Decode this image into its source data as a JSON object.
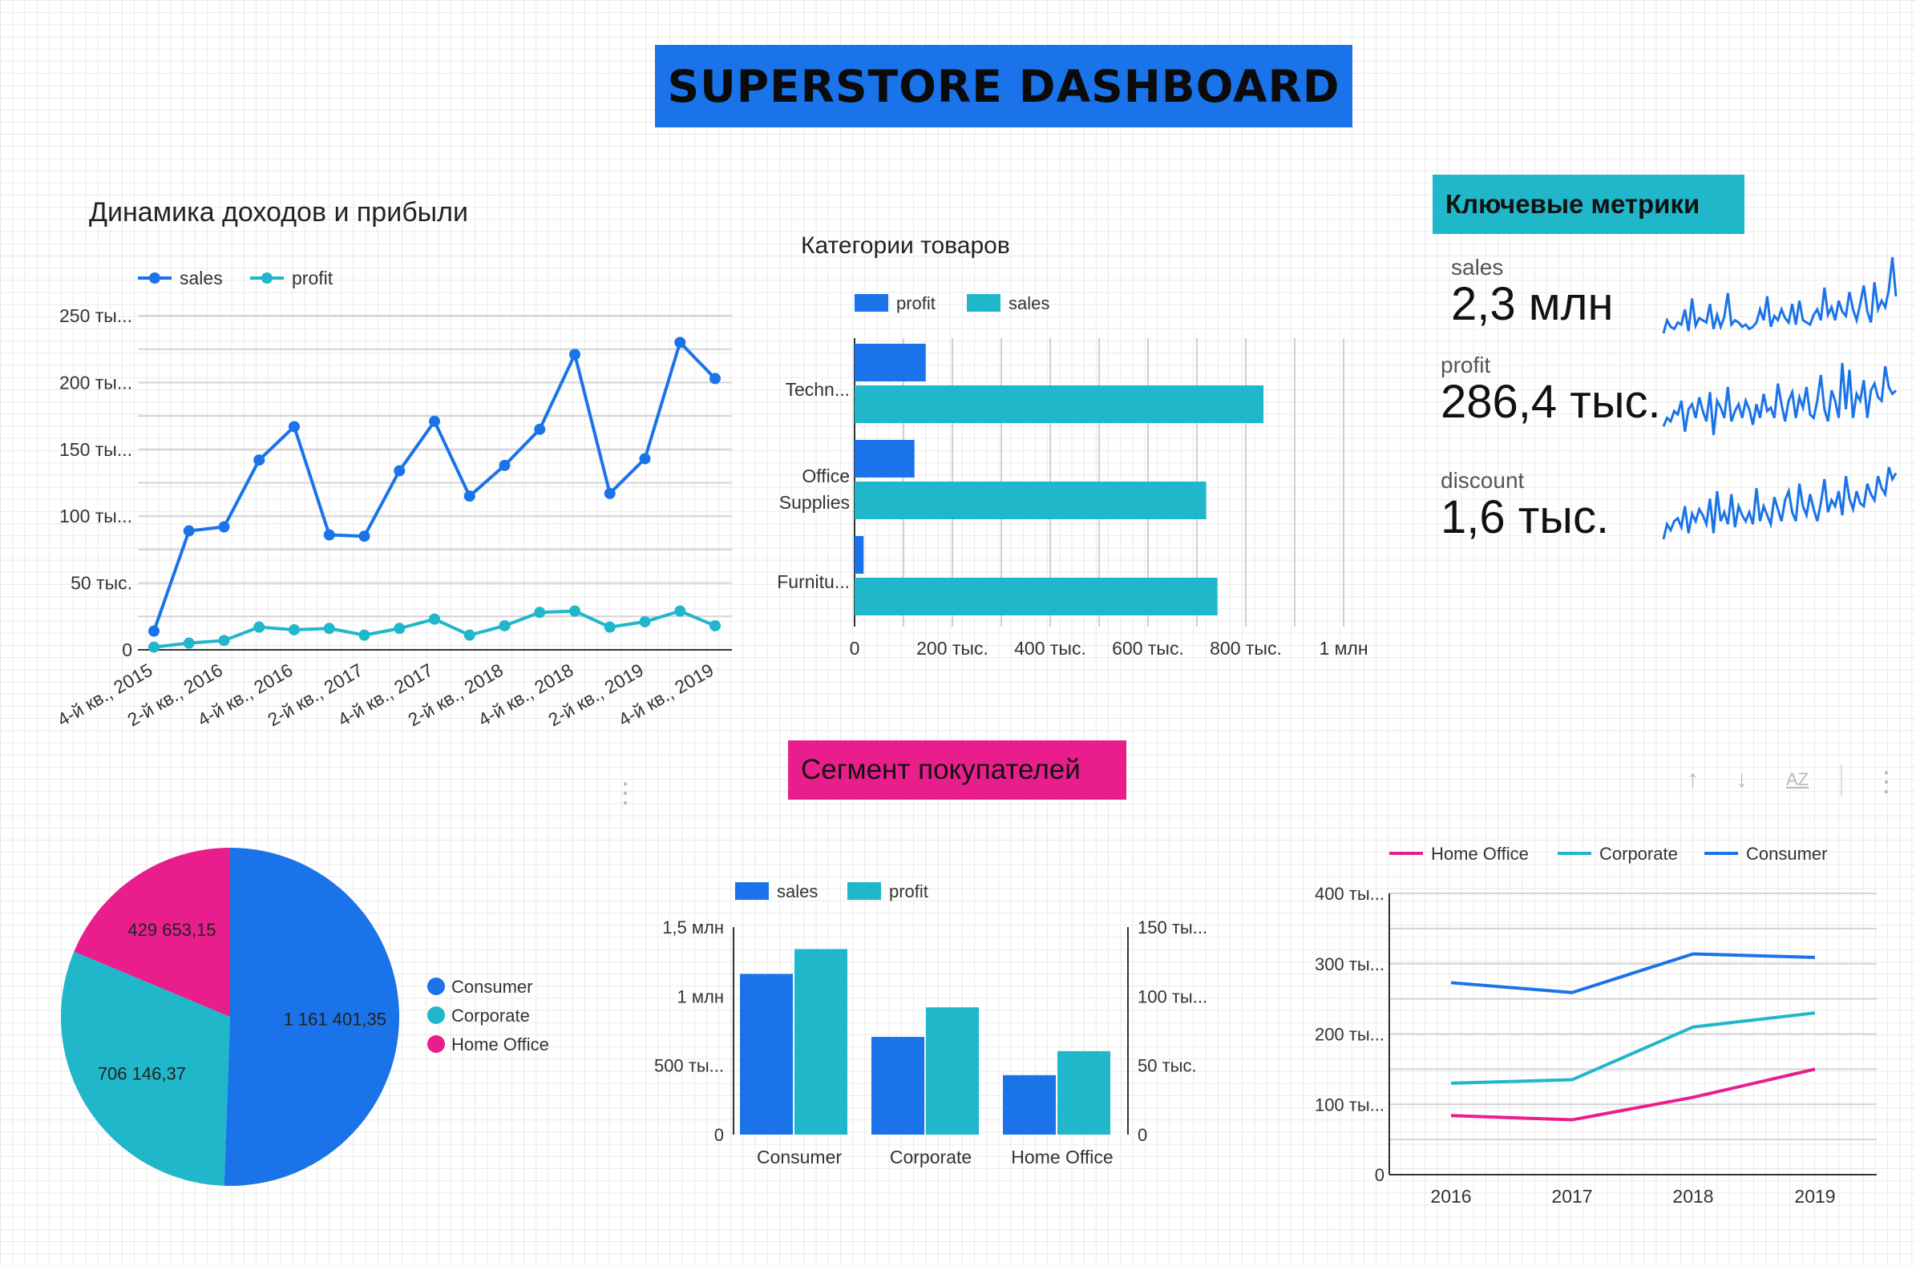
{
  "dashboard": {
    "title": "SUPERSTORE DASHBOARD",
    "metrics_header": "Ключевые метрики",
    "segment_header": "Сегмент покупателей"
  },
  "colors": {
    "blue": "#1a73e8",
    "teal": "#1fb7c9",
    "pink": "#e91e8c"
  },
  "metrics": [
    {
      "label": "sales",
      "value": "2,3 млн",
      "spark": [
        18,
        30,
        24,
        22,
        28,
        26,
        40,
        20,
        50,
        25,
        32,
        30,
        28,
        45,
        22,
        35,
        24,
        33,
        55,
        26,
        30,
        28,
        24,
        26,
        22,
        24,
        28,
        40,
        30,
        52,
        24,
        34,
        30,
        40,
        32,
        28,
        45,
        26,
        48,
        30,
        28,
        26,
        35,
        40,
        30,
        60,
        35,
        42,
        30,
        48,
        38,
        34,
        56,
        40,
        30,
        45,
        62,
        38,
        28,
        65,
        40,
        48,
        42,
        58,
        88,
        52
      ]
    },
    {
      "label": "profit",
      "value": "286,4 тыс.",
      "spark": [
        25,
        30,
        28,
        34,
        32,
        40,
        22,
        35,
        38,
        30,
        42,
        34,
        28,
        45,
        20,
        40,
        36,
        30,
        48,
        28,
        34,
        38,
        30,
        40,
        35,
        26,
        38,
        30,
        44,
        34,
        36,
        30,
        50,
        38,
        28,
        40,
        45,
        30,
        42,
        36,
        48,
        32,
        30,
        40,
        55,
        35,
        28,
        46,
        40,
        30,
        62,
        35,
        58,
        30,
        44,
        40,
        52,
        30,
        46,
        50,
        42,
        40,
        60,
        48,
        44,
        46
      ]
    },
    {
      "label": "discount",
      "value": "1,6 тыс.",
      "spark": [
        18,
        28,
        24,
        30,
        32,
        26,
        40,
        22,
        35,
        30,
        38,
        34,
        28,
        45,
        22,
        50,
        30,
        36,
        28,
        48,
        26,
        40,
        34,
        30,
        36,
        28,
        52,
        30,
        40,
        34,
        28,
        46,
        38,
        30,
        44,
        50,
        36,
        30,
        55,
        40,
        34,
        48,
        38,
        30,
        42,
        58,
        36,
        44,
        40,
        50,
        34,
        60,
        45,
        38,
        50,
        42,
        40,
        55,
        48,
        44,
        60,
        52,
        48,
        66,
        58,
        62
      ]
    }
  ],
  "chart_data": [
    {
      "id": "revenue-profit-trend",
      "type": "line",
      "title": "Динамика доходов и прибыли",
      "x": [
        "4-й кв., 2015",
        "1-й кв., 2016",
        "2-й кв., 2016",
        "3-й кв., 2016",
        "4-й кв., 2016",
        "1-й кв., 2017",
        "2-й кв., 2017",
        "3-й кв., 2017",
        "4-й кв., 2017",
        "1-й кв., 2018",
        "2-й кв., 2018",
        "3-й кв., 2018",
        "4-й кв., 2018",
        "1-й кв., 2019",
        "2-й кв., 2019",
        "3-й кв., 2019",
        "4-й кв., 2019"
      ],
      "x_tick_labels": [
        "4-й кв., 2015",
        "2-й кв., 2016",
        "4-й кв., 2016",
        "2-й кв., 2017",
        "4-й кв., 2017",
        "2-й кв., 2018",
        "4-й кв., 2018",
        "2-й кв., 2019",
        "4-й кв., 2019"
      ],
      "series": [
        {
          "name": "sales",
          "color": "#1a73e8",
          "values": [
            14000,
            89000,
            92000,
            142000,
            167000,
            86000,
            85000,
            134000,
            171000,
            115000,
            138000,
            165000,
            221000,
            117000,
            143000,
            230000,
            203000
          ]
        },
        {
          "name": "profit",
          "color": "#1fb7c9",
          "values": [
            2000,
            5000,
            7000,
            17000,
            15000,
            16000,
            11000,
            16000,
            23000,
            11000,
            18000,
            28000,
            29000,
            17000,
            21000,
            29000,
            18000
          ]
        }
      ],
      "y_ticks": [
        "0",
        "50 тыс.",
        "100 ты...",
        "150 ты...",
        "200 ты...",
        "250 ты..."
      ],
      "ylim": [
        0,
        250000
      ],
      "legend": "top-left",
      "grid": true
    },
    {
      "id": "product-categories",
      "type": "bar",
      "orientation": "horizontal",
      "title": "Категории товаров",
      "categories": [
        "Techn...",
        "Office Supplies",
        "Furnitu..."
      ],
      "series": [
        {
          "name": "profit",
          "color": "#1a73e8",
          "values": [
            145455,
            122491,
            18451
          ]
        },
        {
          "name": "sales",
          "color": "#1fb7c9",
          "values": [
            836154,
            719047,
            741999
          ]
        }
      ],
      "x_ticks": [
        "0",
        "200 тыс.",
        "400 тыс.",
        "600 тыс.",
        "800 тыс.",
        "1 млн"
      ],
      "xlim": [
        0,
        1000000
      ],
      "legend": "top",
      "grid": true
    },
    {
      "id": "segment-pie",
      "type": "pie",
      "categories": [
        "Consumer",
        "Corporate",
        "Home Office"
      ],
      "values": [
        1161401.35,
        706146.37,
        429653.15
      ],
      "value_labels": [
        "1 161 401,35",
        "706 146,37",
        "429 653,15"
      ],
      "colors": [
        "#1a73e8",
        "#1fb7c9",
        "#e91e8c"
      ],
      "legend": "right"
    },
    {
      "id": "segment-bars",
      "type": "bar",
      "categories": [
        "Consumer",
        "Corporate",
        "Home Office"
      ],
      "series": [
        {
          "name": "sales",
          "color": "#1a73e8",
          "axis": "left",
          "values": [
            1161401,
            706146,
            429653
          ]
        },
        {
          "name": "profit",
          "color": "#1fb7c9",
          "axis": "right",
          "values": [
            134119,
            91979,
            60299
          ]
        }
      ],
      "y_left_ticks": [
        "0",
        "500 ты...",
        "1 млн",
        "1,5 млн"
      ],
      "y_left_lim": [
        0,
        1500000
      ],
      "y_right_ticks": [
        "0",
        "50 тыс.",
        "100 ты...",
        "150 ты..."
      ],
      "y_right_lim": [
        0,
        150000
      ],
      "legend": "top"
    },
    {
      "id": "segment-by-year",
      "type": "line",
      "x": [
        "2016",
        "2017",
        "2018",
        "2019"
      ],
      "series": [
        {
          "name": "Home Office",
          "color": "#e91e8c",
          "values": [
            84000,
            78000,
            110000,
            150000
          ]
        },
        {
          "name": "Corporate",
          "color": "#1fb7c9",
          "values": [
            130000,
            135000,
            210000,
            230000
          ]
        },
        {
          "name": "Consumer",
          "color": "#1a73e8",
          "values": [
            273000,
            259000,
            314000,
            309000
          ]
        }
      ],
      "y_ticks": [
        "0",
        "100 ты...",
        "200 ты...",
        "300 ты...",
        "400 ты..."
      ],
      "ylim": [
        0,
        400000
      ],
      "legend": "top",
      "grid": true
    }
  ],
  "toolbar": {
    "sort_asc": "↑",
    "sort_desc": "↓",
    "sort_az": "AZ",
    "more": "⋮"
  }
}
